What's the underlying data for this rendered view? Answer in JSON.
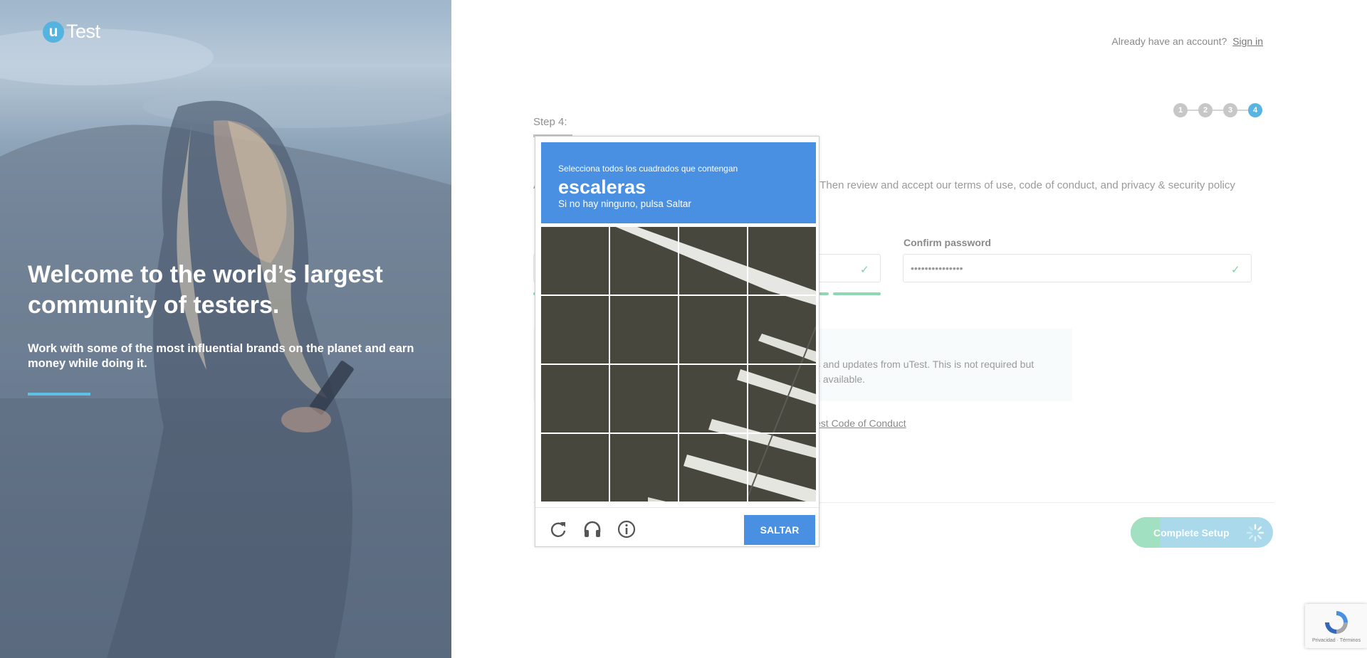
{
  "brand": {
    "logo_letter": "u",
    "logo_text": "Test",
    "accent": "#55b3e0"
  },
  "hero": {
    "title": "Welcome to the world’s largest community of testers.",
    "subtitle": "Work with some of the most influential brands on the planet and earn money while doing it."
  },
  "header": {
    "account_question": "Already have an account?",
    "signin_link": "Sign in"
  },
  "steps": {
    "items": [
      "1",
      "2",
      "3",
      "4"
    ],
    "active": "4",
    "label": "Step 4:"
  },
  "form": {
    "intro_visible_start": "A",
    "intro_visible_end": "Then review and accept our terms of use, code of conduct, and privacy & security policy",
    "password_value": "•••••••••••••••",
    "confirm_label": "Confirm password",
    "confirm_value": "•••••••••••••••",
    "notice_line1": "s and updates from uTest. This is not required but",
    "notice_line2": "s available.",
    "coc_link": "est Code of Conduct",
    "complete_button": "Complete Setup"
  },
  "captcha": {
    "instruction": "Selecciona todos los cuadrados que contengan",
    "target": "escaleras",
    "hint": "Si no hay ninguno, pulsa Saltar",
    "skip_button": "SALTAR",
    "header_color": "#4a90e2",
    "tiles": [
      "1",
      "2",
      "3",
      "4",
      "5",
      "6",
      "7",
      "8",
      "9",
      "10",
      "11",
      "12",
      "13",
      "14",
      "15",
      "16"
    ]
  },
  "recaptcha_badge": {
    "legal": "Privacidad · Términos"
  }
}
